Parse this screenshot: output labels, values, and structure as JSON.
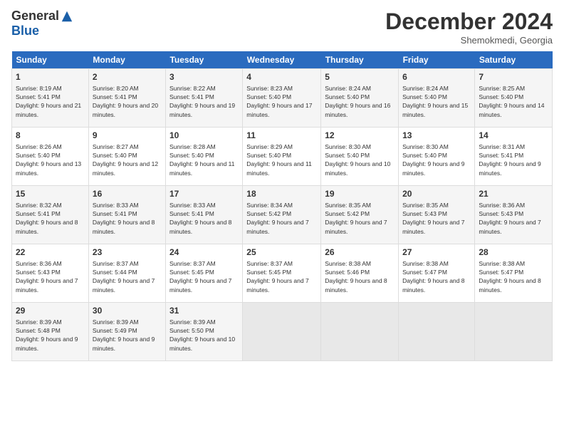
{
  "header": {
    "logo_general": "General",
    "logo_blue": "Blue",
    "month_title": "December 2024",
    "location": "Shemokmedi, Georgia"
  },
  "weekdays": [
    "Sunday",
    "Monday",
    "Tuesday",
    "Wednesday",
    "Thursday",
    "Friday",
    "Saturday"
  ],
  "weeks": [
    [
      {
        "day": "1",
        "sunrise": "8:19 AM",
        "sunset": "5:41 PM",
        "daylight": "9 hours and 21 minutes."
      },
      {
        "day": "2",
        "sunrise": "8:20 AM",
        "sunset": "5:41 PM",
        "daylight": "9 hours and 20 minutes."
      },
      {
        "day": "3",
        "sunrise": "8:22 AM",
        "sunset": "5:41 PM",
        "daylight": "9 hours and 19 minutes."
      },
      {
        "day": "4",
        "sunrise": "8:23 AM",
        "sunset": "5:40 PM",
        "daylight": "9 hours and 17 minutes."
      },
      {
        "day": "5",
        "sunrise": "8:24 AM",
        "sunset": "5:40 PM",
        "daylight": "9 hours and 16 minutes."
      },
      {
        "day": "6",
        "sunrise": "8:24 AM",
        "sunset": "5:40 PM",
        "daylight": "9 hours and 15 minutes."
      },
      {
        "day": "7",
        "sunrise": "8:25 AM",
        "sunset": "5:40 PM",
        "daylight": "9 hours and 14 minutes."
      }
    ],
    [
      {
        "day": "8",
        "sunrise": "8:26 AM",
        "sunset": "5:40 PM",
        "daylight": "9 hours and 13 minutes."
      },
      {
        "day": "9",
        "sunrise": "8:27 AM",
        "sunset": "5:40 PM",
        "daylight": "9 hours and 12 minutes."
      },
      {
        "day": "10",
        "sunrise": "8:28 AM",
        "sunset": "5:40 PM",
        "daylight": "9 hours and 11 minutes."
      },
      {
        "day": "11",
        "sunrise": "8:29 AM",
        "sunset": "5:40 PM",
        "daylight": "9 hours and 11 minutes."
      },
      {
        "day": "12",
        "sunrise": "8:30 AM",
        "sunset": "5:40 PM",
        "daylight": "9 hours and 10 minutes."
      },
      {
        "day": "13",
        "sunrise": "8:30 AM",
        "sunset": "5:40 PM",
        "daylight": "9 hours and 9 minutes."
      },
      {
        "day": "14",
        "sunrise": "8:31 AM",
        "sunset": "5:41 PM",
        "daylight": "9 hours and 9 minutes."
      }
    ],
    [
      {
        "day": "15",
        "sunrise": "8:32 AM",
        "sunset": "5:41 PM",
        "daylight": "9 hours and 8 minutes."
      },
      {
        "day": "16",
        "sunrise": "8:33 AM",
        "sunset": "5:41 PM",
        "daylight": "9 hours and 8 minutes."
      },
      {
        "day": "17",
        "sunrise": "8:33 AM",
        "sunset": "5:41 PM",
        "daylight": "9 hours and 8 minutes."
      },
      {
        "day": "18",
        "sunrise": "8:34 AM",
        "sunset": "5:42 PM",
        "daylight": "9 hours and 7 minutes."
      },
      {
        "day": "19",
        "sunrise": "8:35 AM",
        "sunset": "5:42 PM",
        "daylight": "9 hours and 7 minutes."
      },
      {
        "day": "20",
        "sunrise": "8:35 AM",
        "sunset": "5:43 PM",
        "daylight": "9 hours and 7 minutes."
      },
      {
        "day": "21",
        "sunrise": "8:36 AM",
        "sunset": "5:43 PM",
        "daylight": "9 hours and 7 minutes."
      }
    ],
    [
      {
        "day": "22",
        "sunrise": "8:36 AM",
        "sunset": "5:43 PM",
        "daylight": "9 hours and 7 minutes."
      },
      {
        "day": "23",
        "sunrise": "8:37 AM",
        "sunset": "5:44 PM",
        "daylight": "9 hours and 7 minutes."
      },
      {
        "day": "24",
        "sunrise": "8:37 AM",
        "sunset": "5:45 PM",
        "daylight": "9 hours and 7 minutes."
      },
      {
        "day": "25",
        "sunrise": "8:37 AM",
        "sunset": "5:45 PM",
        "daylight": "9 hours and 7 minutes."
      },
      {
        "day": "26",
        "sunrise": "8:38 AM",
        "sunset": "5:46 PM",
        "daylight": "9 hours and 8 minutes."
      },
      {
        "day": "27",
        "sunrise": "8:38 AM",
        "sunset": "5:47 PM",
        "daylight": "9 hours and 8 minutes."
      },
      {
        "day": "28",
        "sunrise": "8:38 AM",
        "sunset": "5:47 PM",
        "daylight": "9 hours and 8 minutes."
      }
    ],
    [
      {
        "day": "29",
        "sunrise": "8:39 AM",
        "sunset": "5:48 PM",
        "daylight": "9 hours and 9 minutes."
      },
      {
        "day": "30",
        "sunrise": "8:39 AM",
        "sunset": "5:49 PM",
        "daylight": "9 hours and 9 minutes."
      },
      {
        "day": "31",
        "sunrise": "8:39 AM",
        "sunset": "5:50 PM",
        "daylight": "9 hours and 10 minutes."
      },
      null,
      null,
      null,
      null
    ]
  ],
  "labels": {
    "sunrise": "Sunrise:",
    "sunset": "Sunset:",
    "daylight": "Daylight:"
  }
}
